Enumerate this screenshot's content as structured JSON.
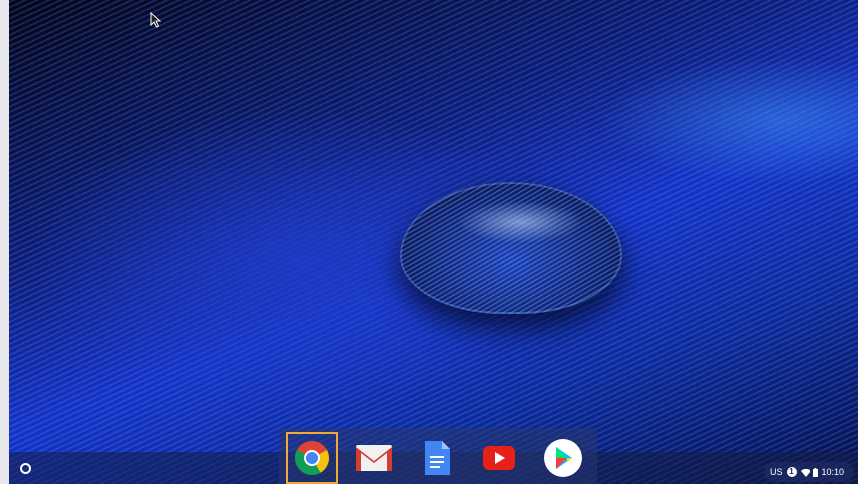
{
  "shelf": {
    "launcher_icon": "launcher-circle-icon",
    "apps": [
      {
        "icon": "chrome-icon",
        "active": true
      },
      {
        "icon": "gmail-icon",
        "active": false
      },
      {
        "icon": "docs-icon",
        "active": false
      },
      {
        "icon": "youtube-icon",
        "active": false
      },
      {
        "icon": "play-store-icon",
        "active": false
      }
    ]
  },
  "tray": {
    "ime": "US",
    "notification_count": "1",
    "wifi_icon": "wifi-icon",
    "battery_icon": "battery-icon",
    "time": "10:10"
  },
  "colors": {
    "active_highlight": "#f2a93b",
    "shelf_bg": "#14204a",
    "wallpaper_blue": "#1533c8"
  }
}
